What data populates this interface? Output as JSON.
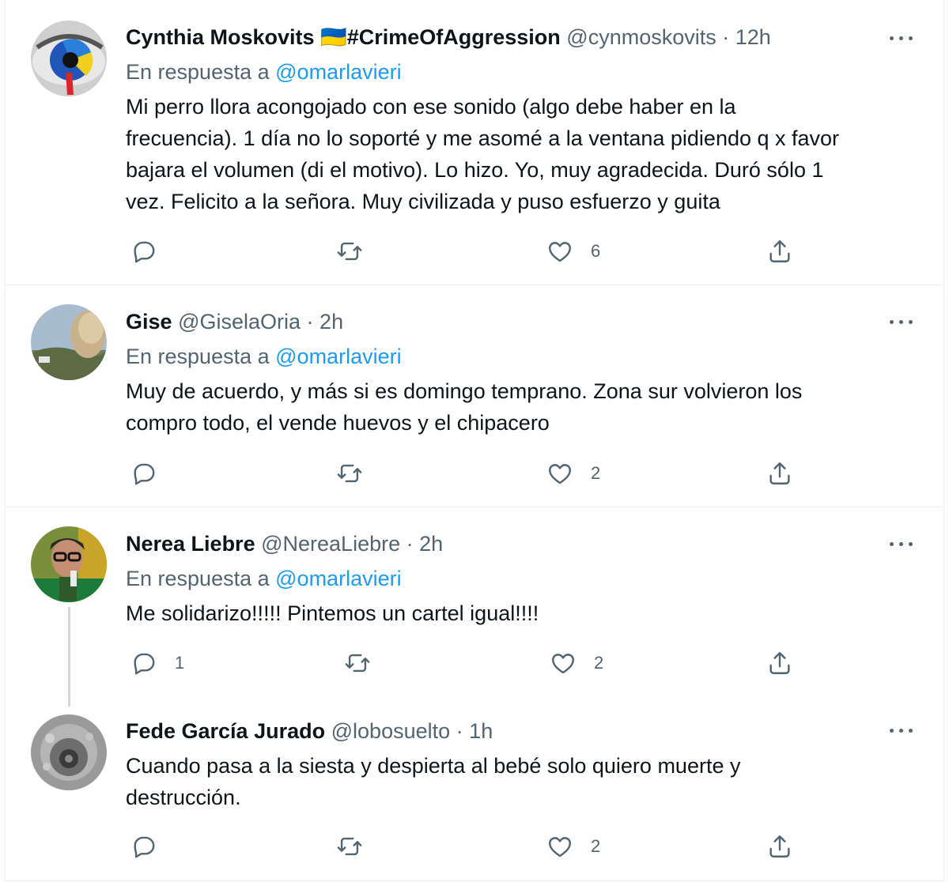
{
  "tweets": [
    {
      "name": "Cynthia Moskovits",
      "flag": "🇺🇦",
      "tag": "#CrimeOfAggression",
      "handle": "@cynmoskovits",
      "dot": "·",
      "time": "12h",
      "reply_prefix": "En respuesta a",
      "reply_mention": "@omarlavieri",
      "lines": [
        "Mi perro llora acongojado con ese sonido (algo debe haber en la",
        "frecuencia). 1 día no lo soporté y me asomé a la ventana pidiendo q x favor",
        "bajara el volumen (di el motivo). Lo hizo. Yo, muy agradecida. Duró sólo 1",
        "vez. Felicito a la señora. Muy civilizada y puso esfuerzo y guita"
      ],
      "reply_count": "",
      "retweet_count": "",
      "like_count": "6"
    },
    {
      "name": "Gise",
      "handle": "@GiselaOria",
      "dot": "·",
      "time": "2h",
      "reply_prefix": "En respuesta a",
      "reply_mention": "@omarlavieri",
      "lines": [
        "Muy de acuerdo, y más si es domingo temprano. Zona sur volvieron los",
        "compro todo, el vende huevos y el chipacero"
      ],
      "reply_count": "",
      "retweet_count": "",
      "like_count": "2"
    },
    {
      "name": "Nerea Liebre",
      "handle": "@NereaLiebre",
      "dot": "·",
      "time": "2h",
      "reply_prefix": "En respuesta a",
      "reply_mention": "@omarlavieri",
      "lines": [
        "Me solidarizo!!!!! Pintemos un cartel igual!!!!"
      ],
      "reply_count": "1",
      "retweet_count": "",
      "like_count": "2"
    },
    {
      "name": "Fede García Jurado",
      "handle": "@lobosuelto",
      "dot": "·",
      "time": "1h",
      "lines": [
        "Cuando pasa a la siesta y despierta al bebé solo quiero muerte y",
        "destrucción."
      ],
      "reply_count": "",
      "retweet_count": "",
      "like_count": "2"
    }
  ],
  "icons": {
    "reply": "reply-icon",
    "retweet": "retweet-icon",
    "like": "like-icon",
    "share": "share-icon",
    "more": "more-icon"
  },
  "colors": {
    "link": "#1d9bf0",
    "secondary_text": "#536471",
    "primary_text": "#0f1419"
  }
}
